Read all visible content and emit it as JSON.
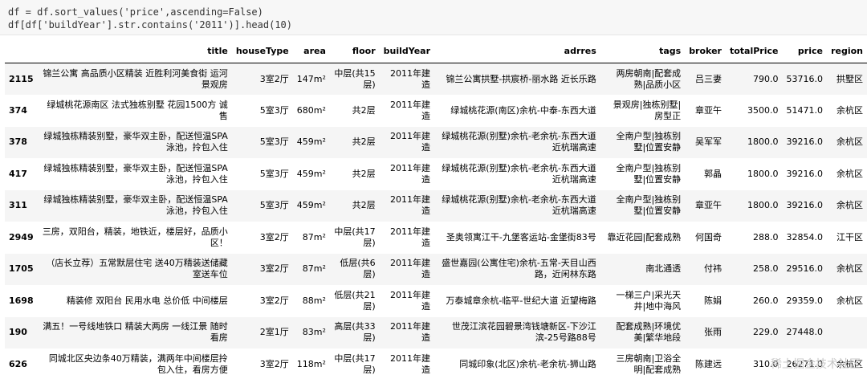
{
  "code": {
    "line1": "df = df.sort_values('price',ascending=False)",
    "line2": "df[df['buildYear'].str.contains('2011')].head(10)"
  },
  "columns": [
    "",
    "title",
    "houseType",
    "area",
    "floor",
    "buildYear",
    "adrres",
    "tags",
    "broker",
    "totalPrice",
    "price",
    "region"
  ],
  "rows": [
    {
      "idx": "2115",
      "title": "锦兰公寓 高品质小区精装 近胜利河美食街 运河景观房",
      "houseType": "3室2厅",
      "area": "147m²",
      "floor": "中层(共15层)",
      "buildYear": "2011年建造",
      "adrres": "锦兰公寓拱墅-拱宸桥-丽水路 近长乐路",
      "tags": "两房朝南|配套成熟|品质小区",
      "broker": "吕三妻",
      "totalPrice": "790.0",
      "price": "53716.0",
      "region": "拱墅区"
    },
    {
      "idx": "374",
      "title": "绿城桃花源南区 法式独栋别墅 花园1500方 诚售",
      "houseType": "5室3厅",
      "area": "680m²",
      "floor": "共2层",
      "buildYear": "2011年建造",
      "adrres": "绿城桃花源(南区)余杭-中泰-东西大道",
      "tags": "景观房|独栋别墅|房型正",
      "broker": "章亚午",
      "totalPrice": "3500.0",
      "price": "51471.0",
      "region": "余杭区"
    },
    {
      "idx": "378",
      "title": "绿城独栋精装别墅，豪华双主卧，配送恒温SPA泳池，拎包入住",
      "houseType": "5室3厅",
      "area": "459m²",
      "floor": "共2层",
      "buildYear": "2011年建造",
      "adrres": "绿城桃花源(别墅)余杭-老余杭-东西大道 近杭瑞高速",
      "tags": "全南户型|独栋别墅|位置安静",
      "broker": "吴军军",
      "totalPrice": "1800.0",
      "price": "39216.0",
      "region": "余杭区"
    },
    {
      "idx": "417",
      "title": "绿城独栋精装别墅，豪华双主卧，配送恒温SPA泳池，拎包入住",
      "houseType": "5室3厅",
      "area": "459m²",
      "floor": "共2层",
      "buildYear": "2011年建造",
      "adrres": "绿城桃花源(别墅)余杭-老余杭-东西大道 近杭瑞高速",
      "tags": "全南户型|独栋别墅|位置安静",
      "broker": "郭晶",
      "totalPrice": "1800.0",
      "price": "39216.0",
      "region": "余杭区"
    },
    {
      "idx": "311",
      "title": "绿城独栋精装别墅，豪华双主卧，配送恒温SPA泳池，拎包入住",
      "houseType": "5室3厅",
      "area": "459m²",
      "floor": "共2层",
      "buildYear": "2011年建造",
      "adrres": "绿城桃花源(别墅)余杭-老余杭-东西大道 近杭瑞高速",
      "tags": "全南户型|独栋别墅|位置安静",
      "broker": "章亚午",
      "totalPrice": "1800.0",
      "price": "39216.0",
      "region": "余杭区"
    },
    {
      "idx": "2949",
      "title": "三房，双阳台，精装，地铁近，楼层好，品质小区！",
      "houseType": "3室2厅",
      "area": "87m²",
      "floor": "中层(共17层)",
      "buildYear": "2011年建造",
      "adrres": "圣奥领寓江干-九堡客运站-金堡街83号",
      "tags": "靠近花园|配套成熟",
      "broker": "何国奇",
      "totalPrice": "288.0",
      "price": "32854.0",
      "region": "江干区"
    },
    {
      "idx": "1705",
      "title": "（店长立荐）五常默层住宅 送40万精装送储藏室送车位",
      "houseType": "3室2厅",
      "area": "87m²",
      "floor": "低层(共6层)",
      "buildYear": "2011年建造",
      "adrres": "盛世嘉园(公寓住宅)余杭-五常-天目山西路，近闲林东路",
      "tags": "南北通透",
      "broker": "付祎",
      "totalPrice": "258.0",
      "price": "29516.0",
      "region": "余杭区"
    },
    {
      "idx": "1698",
      "title": "精装修 双阳台 民用水电 总价低 中间楼层",
      "houseType": "3室2厅",
      "area": "88m²",
      "floor": "低层(共21层)",
      "buildYear": "2011年建造",
      "adrres": "万泰城章余杭-临平-世纪大道 近望梅路",
      "tags": "一梯三户|采光天井|地中海风",
      "broker": "陈娟",
      "totalPrice": "260.0",
      "price": "29359.0",
      "region": "余杭区"
    },
    {
      "idx": "190",
      "title": "满五！一号线地铁口 精装大两房 一线江景 随时看房",
      "houseType": "2室1厅",
      "area": "83m²",
      "floor": "高层(共33层)",
      "buildYear": "2011年建造",
      "adrres": "世茂江滨花园碧景湾钱塘新区-下沙江滨-25号路88号",
      "tags": "配套成熟|环境优美|繁华地段",
      "broker": "张雨",
      "totalPrice": "229.0",
      "price": "27448.0",
      "region": ""
    },
    {
      "idx": "626",
      "title": "同城北区央边条40万精装，满两年中间楼层拎包入住，看房方便",
      "houseType": "3室2厅",
      "area": "118m²",
      "floor": "中层(共17层)",
      "buildYear": "2011年建造",
      "adrres": "同城印象(北区)余杭-老余杭-狮山路",
      "tags": "三房朝南|卫浴全明|配套成熟",
      "broker": "陈建远",
      "totalPrice": "310.0",
      "price": "26271.0",
      "region": "余杭区"
    }
  ],
  "watermark": "稀土掘金技术社区"
}
